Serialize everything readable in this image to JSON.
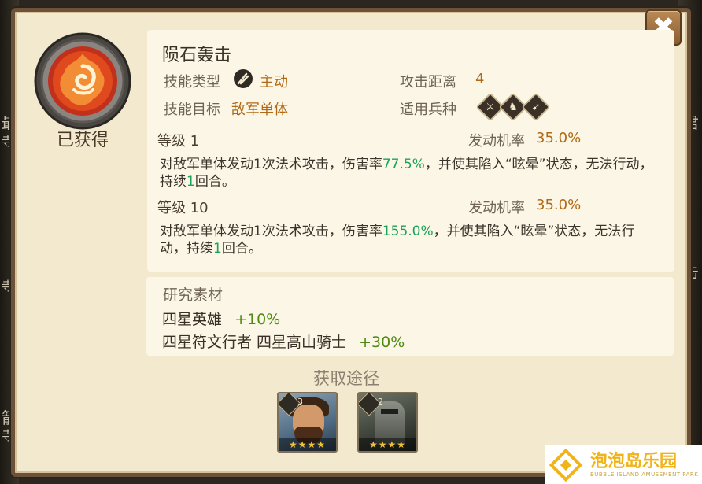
{
  "background": {
    "left_labels": [
      "最",
      "寺",
      "寺",
      "箭",
      "寺"
    ],
    "right_labels": [
      "君",
      "击"
    ]
  },
  "close_button": {
    "icon": "close-icon",
    "label": "✖"
  },
  "skill": {
    "icon": "meteor-skill-icon",
    "status": "已获得",
    "name": "陨石轰击",
    "type_label": "技能类型",
    "type_icon": "active-skill-icon",
    "type_value": "主动",
    "range_label": "攻击距离",
    "range_value": "4",
    "target_label": "技能目标",
    "target_value": "敌军单体",
    "troops_label": "适用兵种",
    "troop_icons": [
      "infantry-icon",
      "cavalry-icon",
      "archer-icon"
    ]
  },
  "levels": [
    {
      "level_label": "等级 1",
      "chance_label": "发动机率",
      "chance_value": "35.0%",
      "desc_a": "对敌军单体发动1次法术攻击，伤害率",
      "desc_rate": "77.5%",
      "desc_b": "，并使其陷入“眩晕”状态，无法行动，持续",
      "desc_turns": "1",
      "desc_c": "回合。"
    },
    {
      "level_label": "等级 10",
      "chance_label": "发动机率",
      "chance_value": "35.0%",
      "desc_a": "对敌军单体发动1次法术攻击，伤害率",
      "desc_rate": "155.0%",
      "desc_b": "，并使其陷入“眩晕”状态，无法行动，持续",
      "desc_turns": "1",
      "desc_c": "回合。"
    }
  ],
  "materials": {
    "title": "研究素材",
    "line1_text": "四星英雄",
    "line1_bonus": "+10%",
    "line2_text": "四星符文行者 四星高山骑士",
    "line2_bonus": "+30%"
  },
  "routes": {
    "title": "获取途径",
    "heroes": [
      {
        "name": "bearded-hero-portrait",
        "stars": "★★★★",
        "level_badge": "3"
      },
      {
        "name": "armored-knight-portrait",
        "stars": "★★★★",
        "level_badge": "2"
      }
    ]
  },
  "watermark": {
    "main": "泡泡岛乐园",
    "sub": "BUBBLE ISLAND AMUSEMENT PARK"
  },
  "colors": {
    "panel_bg": "#f2e9cf",
    "value_orange": "#b06a16",
    "rate_green": "#1aa35a",
    "bonus_green": "#4f8a12",
    "close_brown": "#8a5d31"
  }
}
